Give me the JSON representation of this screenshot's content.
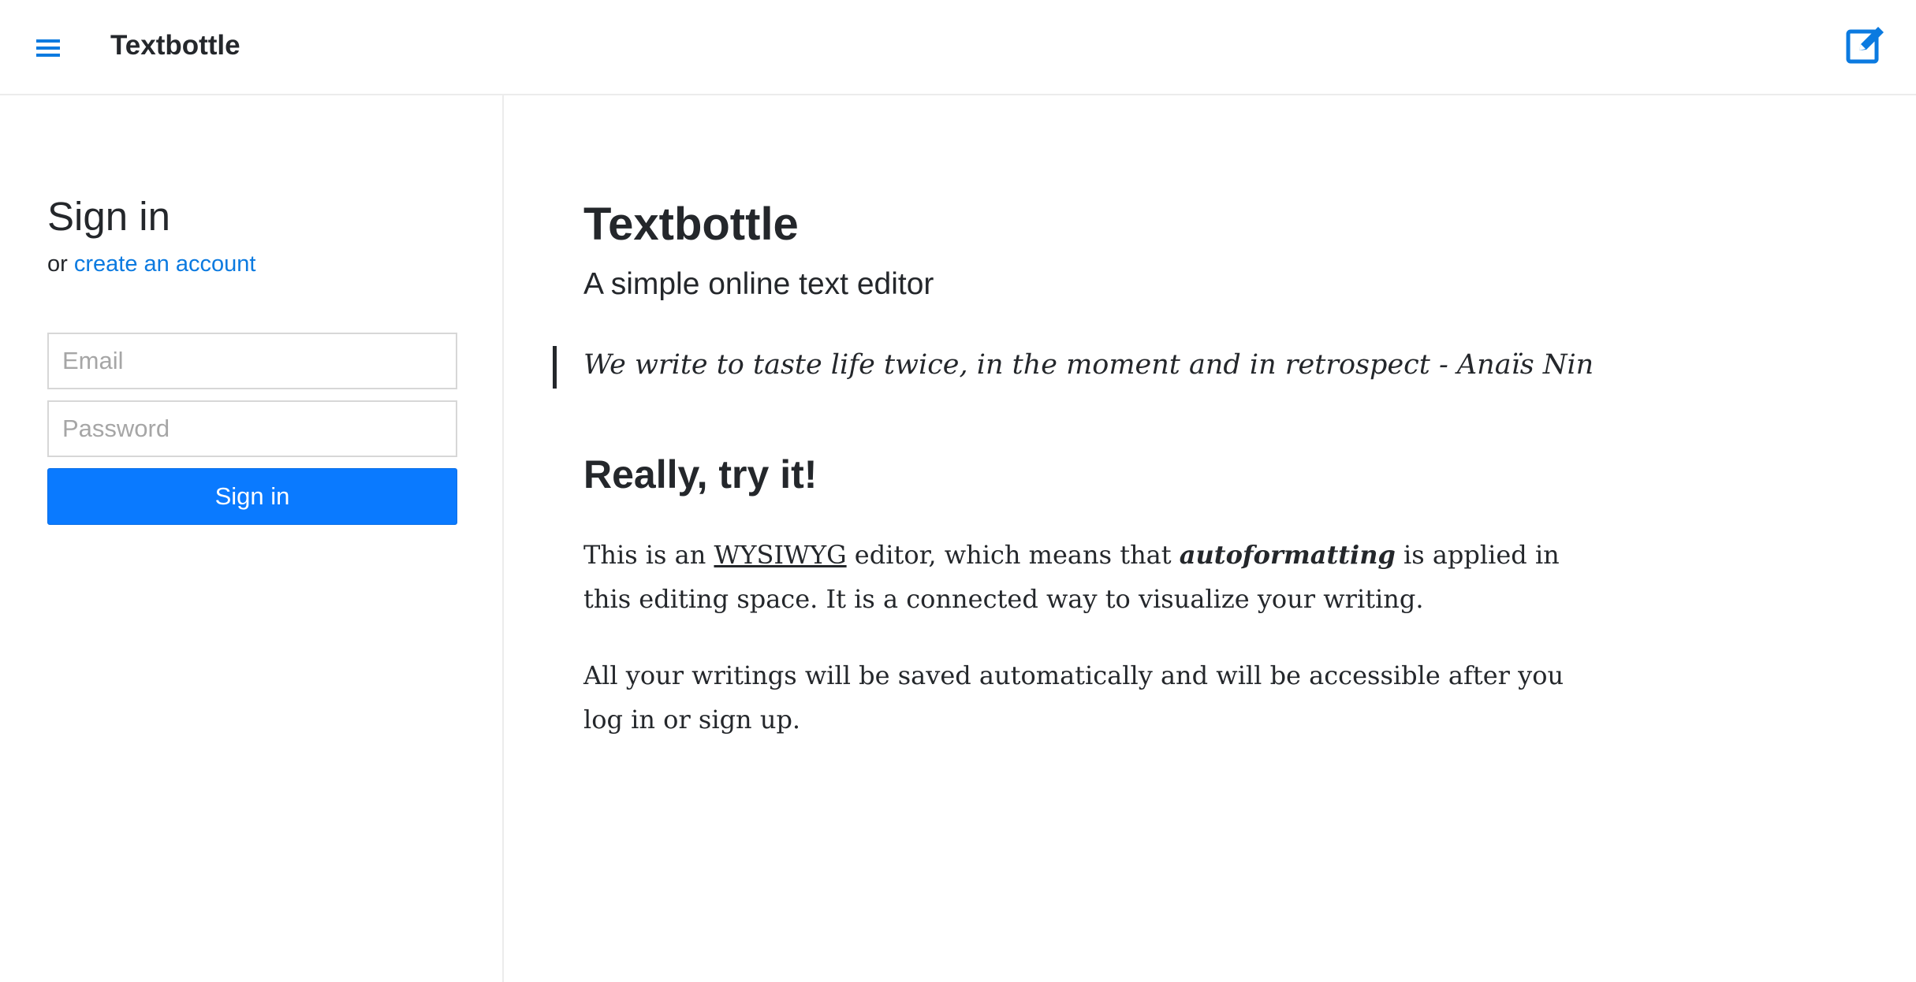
{
  "header": {
    "title": "Textbottle",
    "menu_icon": "hamburger-icon",
    "compose_icon": "compose-icon",
    "accent_color": "#0b7ae0"
  },
  "sidebar": {
    "heading": "Sign in",
    "or_text": "or",
    "create_account_link": "create an account",
    "email_placeholder": "Email",
    "password_placeholder": "Password",
    "email_value": "",
    "password_value": "",
    "submit_label": "Sign in",
    "submit_color": "#0a7aff"
  },
  "document": {
    "title": "Textbottle",
    "subtitle": "A simple online text editor",
    "quote": "We write to taste life twice, in the moment and in retrospect - Anaïs Nin",
    "heading2": "Really, try it!",
    "para1": {
      "pre": "This is an ",
      "link": "WYSIWYG",
      "mid": " editor, which means that ",
      "emph": "autoformatting",
      "post": " is applied in this editing space.  It is a connected way to visualize your writing."
    },
    "para2": "All your writings will be saved automatically and will be accessible after you log in or sign up."
  }
}
